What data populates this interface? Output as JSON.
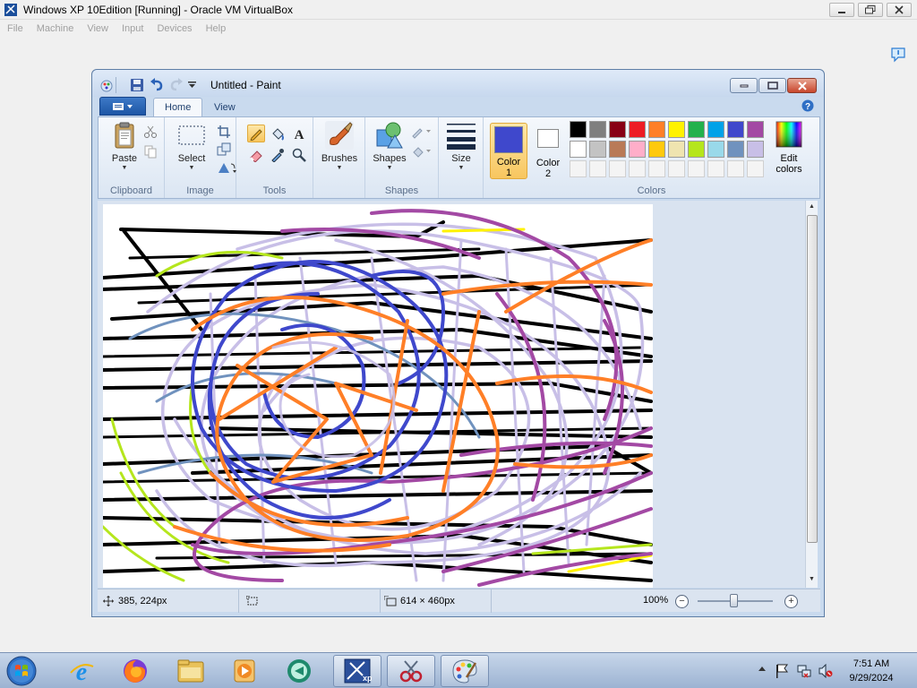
{
  "vbox": {
    "title": "Windows XP 10Edition [Running] - Oracle VM VirtualBox",
    "menu": [
      "File",
      "Machine",
      "View",
      "Input",
      "Devices",
      "Help"
    ]
  },
  "paint": {
    "title": "Untitled - Paint",
    "tabs": {
      "home": "Home",
      "view": "View"
    },
    "groups": {
      "clipboard": "Clipboard",
      "image": "Image",
      "tools": "Tools",
      "shapes": "Shapes",
      "colors": "Colors"
    },
    "buttons": {
      "paste": "Paste",
      "select": "Select",
      "brushes": "Brushes",
      "shapes": "Shapes",
      "size": "Size",
      "color1_line1": "Color",
      "color1_line2": "1",
      "color2_line1": "Color",
      "color2_line2": "2",
      "edit_colors_line1": "Edit",
      "edit_colors_line2": "colors"
    },
    "color1_value": "#3f48cc",
    "color2_value": "#ffffff",
    "palette": [
      [
        "#000000",
        "#7f7f7f",
        "#880015",
        "#ed1c24",
        "#ff7f27",
        "#fff200",
        "#22b14c",
        "#00a2e8",
        "#3f48cc",
        "#a349a4"
      ],
      [
        "#ffffff",
        "#c3c3c3",
        "#b97a57",
        "#ffaec9",
        "#ffc90e",
        "#efe4b0",
        "#b5e61d",
        "#99d9ea",
        "#7092be",
        "#c8bfe7"
      ]
    ],
    "status": {
      "cursor_pos": "385, 224px",
      "canvas_size": "614 × 460px",
      "zoom": "100%"
    }
  },
  "taskbar": {
    "time": "7:51 AM",
    "date": "9/29/2024"
  }
}
